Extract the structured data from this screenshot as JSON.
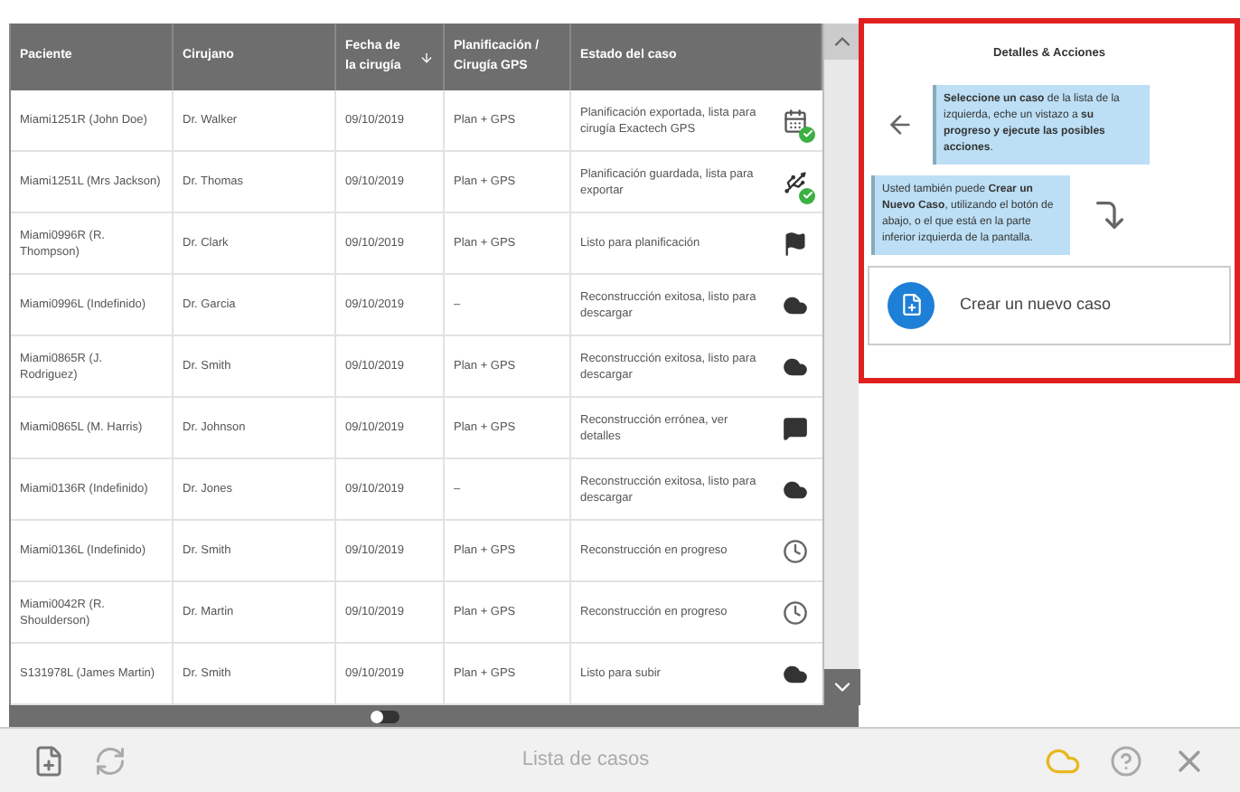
{
  "table": {
    "columns": [
      {
        "label": "Paciente",
        "sorted": false
      },
      {
        "label": "Cirujano",
        "sorted": false
      },
      {
        "label": "Fecha de la cirugía",
        "sorted": true
      },
      {
        "label": "Planificación / Cirugía GPS",
        "sorted": false
      },
      {
        "label": "Estado del caso",
        "sorted": false
      }
    ],
    "rows": [
      {
        "patient": "Miami1251R (John Doe)",
        "surgeon": "Dr. Walker",
        "date": "09/10/2019",
        "plan": "Plan + GPS",
        "status": "Planificación exportada, lista para cirugía Exactech GPS",
        "kind": "exported",
        "done": true
      },
      {
        "patient": "Miami1251L (Mrs Jackson)",
        "surgeon": "Dr. Thomas",
        "date": "09/10/2019",
        "plan": "Plan + GPS",
        "status": "Planificación guardada, lista para exportar",
        "kind": "saved",
        "done": true
      },
      {
        "patient": "Miami0996R (R. Thompson)",
        "surgeon": "Dr. Clark",
        "date": "09/10/2019",
        "plan": "Plan + GPS",
        "status": "Listo para planificación",
        "kind": "ready",
        "done": false
      },
      {
        "patient": "Miami0996L (Indefinido)",
        "surgeon": "Dr. Garcia",
        "date": "09/10/2019",
        "plan": "–",
        "status": "Reconstrucción exitosa, listo para descargar",
        "kind": "reconstructed",
        "done": false
      },
      {
        "patient": "Miami0865R (J. Rodriguez)",
        "surgeon": "Dr. Smith",
        "date": "09/10/2019",
        "plan": "Plan + GPS",
        "status": "Reconstrucción exitosa, listo para descargar",
        "kind": "reconstructed",
        "done": false
      },
      {
        "patient": "Miami0865L (M. Harris)",
        "surgeon": "Dr. Johnson",
        "date": "09/10/2019",
        "plan": "Plan + GPS",
        "status": "Reconstrucción errónea, ver detalles",
        "kind": "failed",
        "done": false
      },
      {
        "patient": "Miami0136R (Indefinido)",
        "surgeon": "Dr. Jones",
        "date": "09/10/2019",
        "plan": "–",
        "status": "Reconstrucción exitosa, listo para descargar",
        "kind": "reconstructed",
        "done": false
      },
      {
        "patient": "Miami0136L (Indefinido)",
        "surgeon": "Dr. Smith",
        "date": "09/10/2019",
        "plan": "Plan + GPS",
        "status": "Reconstrucción en progreso",
        "kind": "processing",
        "done": false
      },
      {
        "patient": "Miami0042R (R. Shoulderson)",
        "surgeon": "Dr. Martin",
        "date": "09/10/2019",
        "plan": "Plan + GPS",
        "status": "Reconstrucción en progreso",
        "kind": "processing",
        "done": false
      },
      {
        "patient": "S131978L (James Martin)",
        "surgeon": "Dr. Smith",
        "date": "09/10/2019",
        "plan": "Plan + GPS",
        "status": "Listo para subir",
        "kind": "upload",
        "done": false
      }
    ]
  },
  "archive_toggle": {
    "on": false
  },
  "details": {
    "title": "Detalles & Acciones",
    "hint_select": "**Seleccione un caso** de la lista de la izquierda, eche un vistazo a **su progreso y ejecute las posibles acciones**.",
    "hint_create": "Usted también puede **Crear un Nuevo Caso**, utilizando el botón de abajo, o el que está en la parte inferior izquierda de la pantalla.",
    "create_button": "Crear un nuevo caso"
  },
  "footer": {
    "title": "Lista de casos"
  }
}
